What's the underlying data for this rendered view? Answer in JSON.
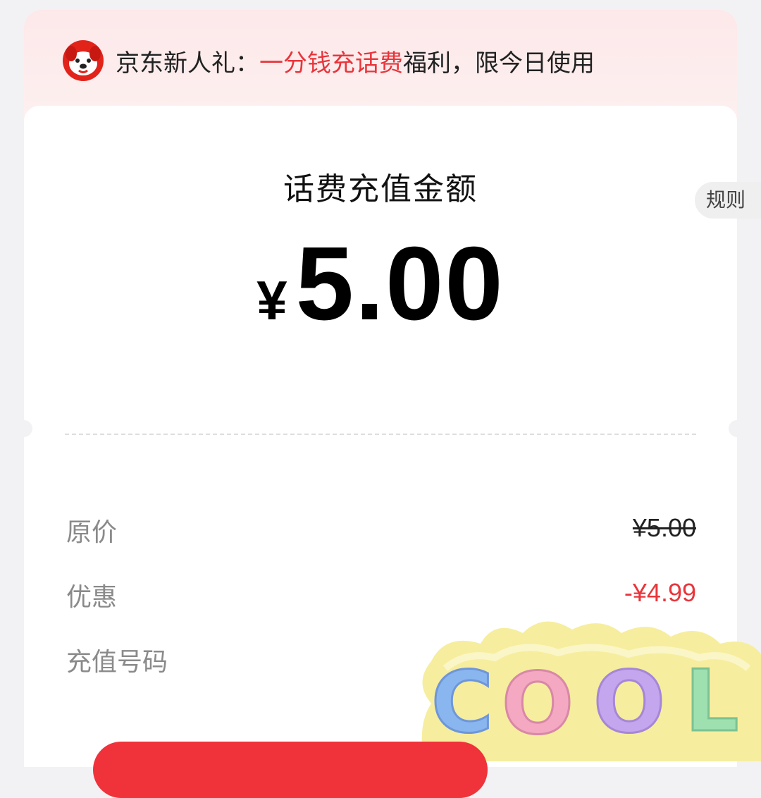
{
  "banner": {
    "prefix": "京东新人礼：",
    "highlight": "一分钱充话费",
    "suffix": "福利，限今日使用",
    "logo_icon": "jd-joy-dog-icon"
  },
  "rules_label": "规则",
  "amount": {
    "title": "话费充值金额",
    "currency": "¥",
    "value": "5.00"
  },
  "details": {
    "original_price_label": "原价",
    "original_price_value": "¥5.00",
    "discount_label": "优惠",
    "discount_value": "-¥4.99",
    "phone_label": "充值号码"
  },
  "sticker": {
    "text": "COOL",
    "icon": "cool-sticker-icon"
  },
  "colors": {
    "accent": "#e8353b",
    "banner_bg": "#fde8ea",
    "page_bg": "#f2f2f4"
  }
}
